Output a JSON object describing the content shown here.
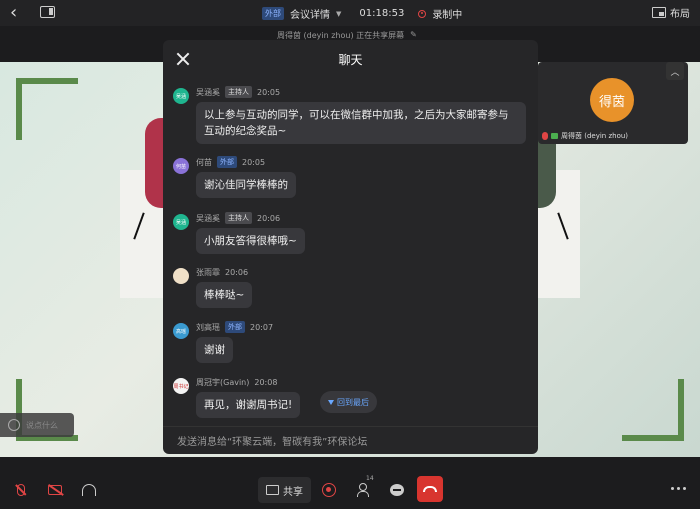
{
  "topbar": {
    "external_tag": "外部",
    "meeting_details": "会议详情",
    "timer": "01:18:53",
    "recording": "录制中",
    "layout_label": "布局",
    "share_note": "周得茵 (deyin zhou) 正在共享屏幕"
  },
  "participant_tile": {
    "avatar_text": "得茵",
    "name": "周得茵 (deyin zhou)"
  },
  "comment_pill": {
    "placeholder": "说点什么"
  },
  "chat": {
    "title": "聊天",
    "scroll_to_bottom": "回到最后",
    "input_placeholder": "发送消息给“环聚云端，智碳有我”环保论坛",
    "messages": [
      {
        "avatar": "吴涵",
        "sender": "吴涵奚",
        "tag": "主持人",
        "time": "20:05",
        "text": "以上参与互动的同学，可以在微信群中加我，之后为大家邮寄参与互动的纪念奖品~"
      },
      {
        "avatar": "何苗",
        "sender": "何苗",
        "tag": "外部",
        "time": "20:05",
        "text": "谢沁佳同学棒棒的"
      },
      {
        "avatar": "吴涵",
        "sender": "吴涵奚",
        "tag": "主持人",
        "time": "20:06",
        "text": "小朋友答得很棒哦~"
      },
      {
        "avatar": "",
        "sender": "张雨霏",
        "tag": "",
        "time": "20:06",
        "text": "棒棒哒~"
      },
      {
        "avatar": "高瑶",
        "sender": "刘高瑶",
        "tag": "外部",
        "time": "20:07",
        "text": "谢谢"
      },
      {
        "avatar": "周书记",
        "sender": "周冠宇(Gavin)",
        "tag": "",
        "time": "20:08",
        "text": "再见，谢谢周书记!"
      }
    ]
  },
  "toolbar": {
    "share_label": "共享",
    "participant_count": "14"
  },
  "colors": {
    "accent_blue": "#6aa8ff",
    "danger_red": "#d8352f",
    "host_avatar": "#1fb58f",
    "tile_avatar": "#e8922a"
  }
}
